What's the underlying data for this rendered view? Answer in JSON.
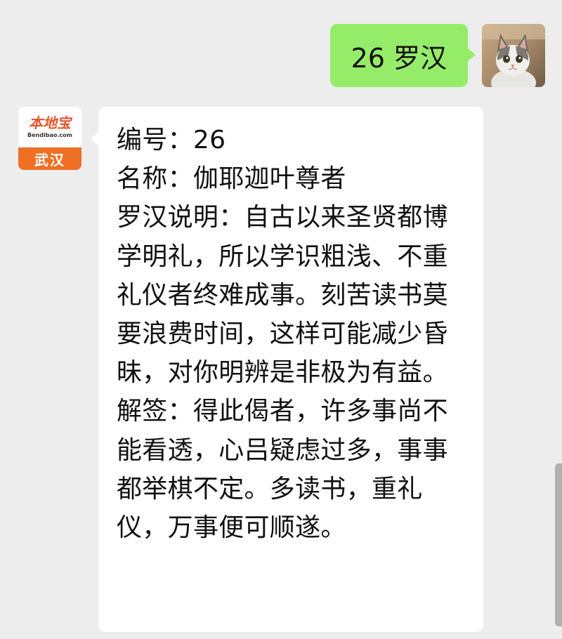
{
  "outgoing": {
    "text": "26 罗汉",
    "bubble_color": "#95ec69",
    "avatar_icon": "cat-photo-icon"
  },
  "incoming": {
    "avatar": {
      "brand": "本地宝",
      "url": "Bendibao.com",
      "city": "武汉",
      "brand_color": "#ef6f24"
    },
    "lines": [
      "编号：26",
      "名称：伽耶迦叶尊者",
      "罗汉说明：自古以来圣贤都博学明礼，所以学识粗浅、不重礼仪者终难成事。刻苦读书莫要浪费时间，这样可能减少昏昧，对你明辨是非极为有益。",
      "解签：得此偈者，许多事尚不能看透，心吕疑虑过多，事事都举棋不定。多读书，重礼仪，万事便可顺遂。"
    ]
  },
  "colors": {
    "background": "#ededed",
    "incoming_bubble": "#ffffff"
  }
}
